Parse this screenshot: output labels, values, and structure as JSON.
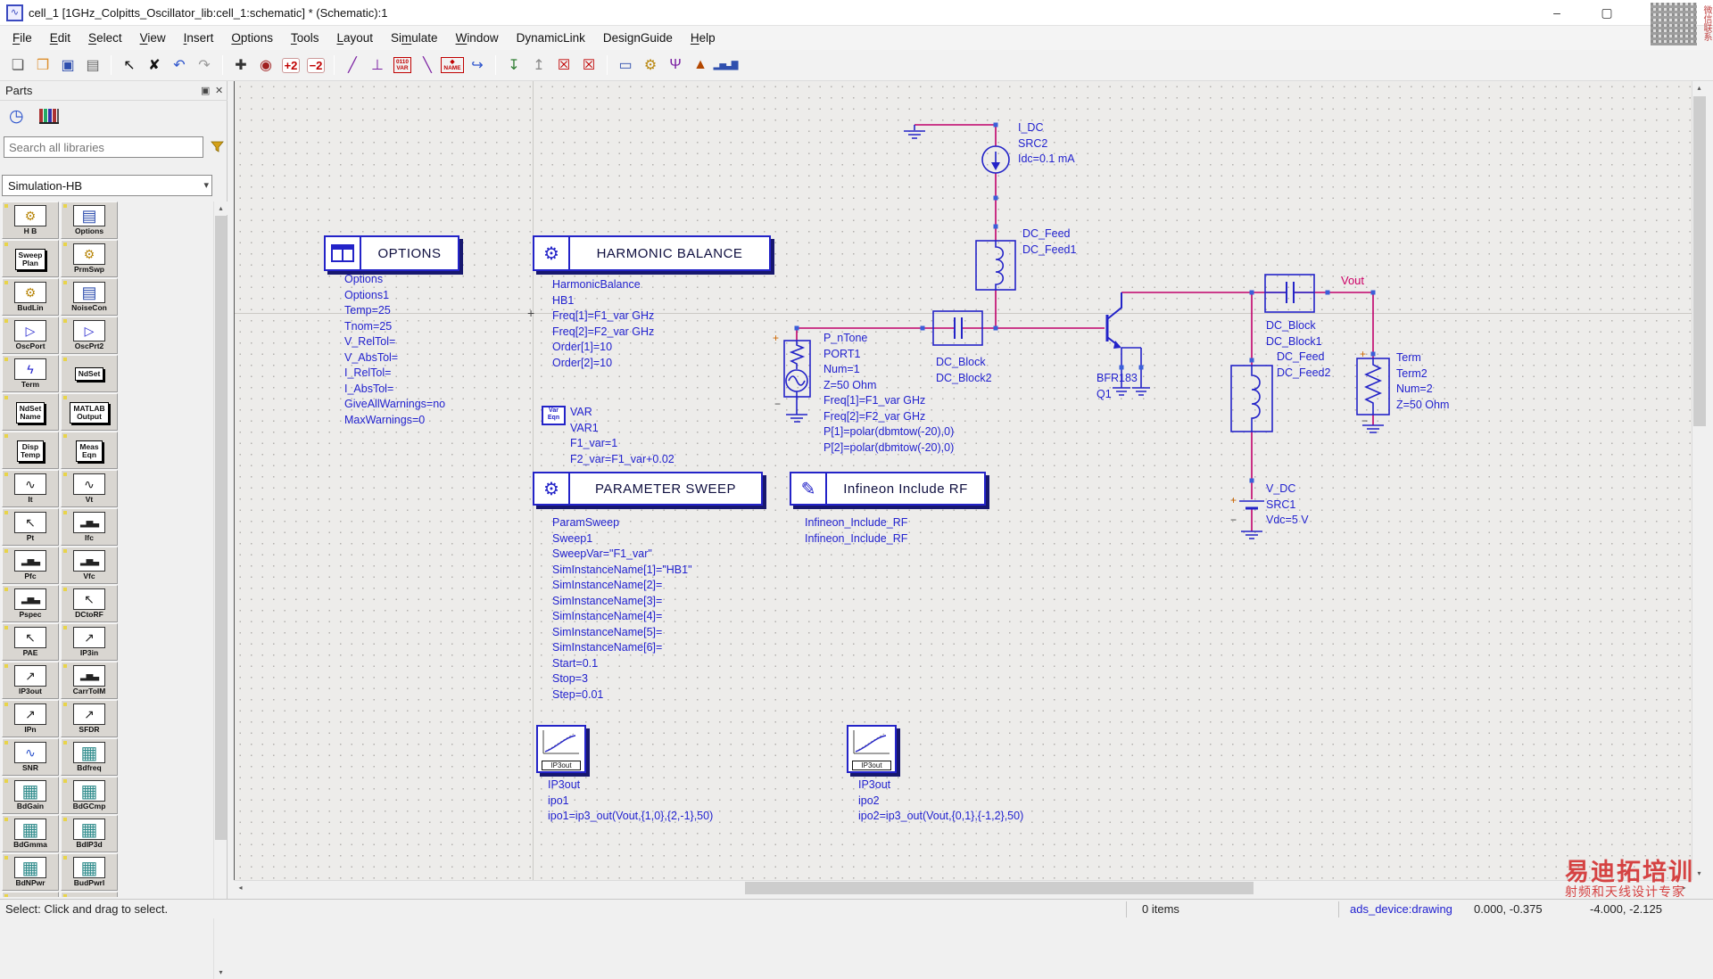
{
  "colors": {
    "symbol_blue": "#2323c8",
    "wire_magenta": "#c0006a",
    "type_cyan": "#2da0e0",
    "param_blue": "#2222cf",
    "watermark_red": "#d54242"
  },
  "window": {
    "title": "cell_1 [1GHz_Colpitts_Oscillator_lib:cell_1:schematic] * (Schematic):1",
    "minimize_glyph": "–",
    "maximize_glyph": "▢"
  },
  "menu": [
    {
      "pre": "",
      "u": "F",
      "post": "ile"
    },
    {
      "pre": "",
      "u": "E",
      "post": "dit"
    },
    {
      "pre": "",
      "u": "S",
      "post": "elect"
    },
    {
      "pre": "",
      "u": "V",
      "post": "iew"
    },
    {
      "pre": "",
      "u": "I",
      "post": "nsert"
    },
    {
      "pre": "",
      "u": "O",
      "post": "ptions"
    },
    {
      "pre": "",
      "u": "T",
      "post": "ools"
    },
    {
      "pre": "",
      "u": "L",
      "post": "ayout"
    },
    {
      "pre": "Si",
      "u": "m",
      "post": "ulate"
    },
    {
      "pre": "",
      "u": "W",
      "post": "indow"
    },
    {
      "pre": "DynamicLink",
      "u": "",
      "post": ""
    },
    {
      "pre": "DesignGuide",
      "u": "",
      "post": ""
    },
    {
      "pre": "",
      "u": "H",
      "post": "elp"
    }
  ],
  "toolbar": [
    {
      "cls": "tbtn",
      "name": "new-design",
      "glyph": "❏",
      "color": "#555",
      "inter": "true"
    },
    {
      "cls": "tbtn",
      "name": "open-design",
      "glyph": "❒",
      "color": "#dd8f2d",
      "inter": "true"
    },
    {
      "cls": "tbtn",
      "name": "save-design",
      "glyph": "▣",
      "color": "#2f4fae",
      "inter": "true"
    },
    {
      "cls": "tbtn",
      "name": "print",
      "glyph": "▤",
      "color": "#666",
      "inter": "true"
    },
    {
      "cls": "tsep",
      "name": "separator",
      "glyph": "",
      "color": "",
      "inter": "false"
    },
    {
      "cls": "tbtn",
      "name": "select-pointer",
      "glyph": "↖",
      "color": "#111",
      "inter": "true"
    },
    {
      "cls": "tbtn",
      "name": "delete",
      "glyph": "✘",
      "color": "#111",
      "inter": "true"
    },
    {
      "cls": "tbtn",
      "name": "undo",
      "glyph": "↶",
      "color": "#2a52cc",
      "inter": "true"
    },
    {
      "cls": "tbtn",
      "name": "redo",
      "glyph": "↷",
      "color": "#999",
      "inter": "true"
    },
    {
      "cls": "tsep",
      "name": "separator",
      "glyph": "",
      "color": "",
      "inter": "false"
    },
    {
      "cls": "tbtn",
      "name": "pan",
      "glyph": "✚",
      "color": "#333",
      "inter": "true"
    },
    {
      "cls": "tbtn",
      "name": "zoom-area",
      "glyph": "◉",
      "color": "#a02020",
      "inter": "true"
    },
    {
      "cls": "tbtn zoomtxt",
      "name": "zoom-in",
      "glyph": "+2",
      "color": "#c00000",
      "inter": "true"
    },
    {
      "cls": "tbtn zoomtxt",
      "name": "zoom-out",
      "glyph": "−2",
      "color": "#c00000",
      "inter": "true"
    },
    {
      "cls": "tsep",
      "name": "separator",
      "glyph": "",
      "color": "",
      "inter": "false"
    },
    {
      "cls": "tbtn",
      "name": "insert-wire",
      "glyph": "╱",
      "color": "#7a1fa2",
      "inter": "true"
    },
    {
      "cls": "tbtn",
      "name": "insert-ground",
      "glyph": "⊥",
      "color": "#7a1fa2",
      "inter": "true"
    },
    {
      "cls": "tbtn varbox",
      "name": "insert-var",
      "glyph": "0110\nVAR",
      "color": "#c00000",
      "inter": "true"
    },
    {
      "cls": "tbtn",
      "name": "insert-wire-label",
      "glyph": "╲",
      "color": "#7a1fa2",
      "inter": "true"
    },
    {
      "cls": "tbtn namebox",
      "name": "node-name",
      "glyph": "◆\nNAME",
      "color": "#c00000",
      "inter": "true"
    },
    {
      "cls": "tbtn",
      "name": "wire-route",
      "glyph": "↪",
      "color": "#2a52cc",
      "inter": "true"
    },
    {
      "cls": "tsep",
      "name": "separator",
      "glyph": "",
      "color": "",
      "inter": "false"
    },
    {
      "cls": "tbtn",
      "name": "push-into-hierarchy",
      "glyph": "↧",
      "color": "#2e7d32",
      "inter": "true"
    },
    {
      "cls": "tbtn",
      "name": "pop-out-of-hierarchy",
      "glyph": "↥",
      "color": "#8a8a8a",
      "inter": "true"
    },
    {
      "cls": "tbtn",
      "name": "deactivate-component",
      "glyph": "☒",
      "color": "#c00000",
      "inter": "true"
    },
    {
      "cls": "tbtn",
      "name": "deactivate-short",
      "glyph": "☒",
      "color": "#c00000",
      "inter": "true"
    },
    {
      "cls": "tsep",
      "name": "separator",
      "glyph": "",
      "color": "",
      "inter": "false"
    },
    {
      "cls": "tbtn",
      "name": "data-display-window",
      "glyph": "▭",
      "color": "#2f4fae",
      "inter": "true"
    },
    {
      "cls": "tbtn",
      "name": "simulation-settings",
      "glyph": "⚙",
      "color": "#b8860b",
      "inter": "true"
    },
    {
      "cls": "tbtn",
      "name": "tune-parameters",
      "glyph": "Ψ",
      "color": "#7a1fa2",
      "inter": "true"
    },
    {
      "cls": "tbtn",
      "name": "simulate",
      "glyph": "▲",
      "color": "#b34700",
      "inter": "true"
    },
    {
      "cls": "tbtn spectrum",
      "name": "spectrum-display",
      "glyph": "▂▅▃▇",
      "color": "#2f4fae",
      "inter": "true"
    }
  ],
  "parts_panel": {
    "title": "Parts",
    "dock_icon": "▣",
    "close_icon": "✕",
    "history_icon": "◷",
    "search_placeholder": "Search all libraries",
    "palette": "Simulation-HB",
    "combo_arrow": "▾",
    "parts": [
      {
        "label": "H B",
        "icon": "gears"
      },
      {
        "label": "Options",
        "icon": "window"
      },
      {
        "label": "Sweep\nPlan",
        "icon": "textbox"
      },
      {
        "label": "PrmSwp",
        "icon": "gears"
      },
      {
        "label": "BudLin",
        "icon": "gears"
      },
      {
        "label": "NoiseCon",
        "icon": "window"
      },
      {
        "label": "OscPort",
        "icon": "osc"
      },
      {
        "label": "OscPrt2",
        "icon": "osc"
      },
      {
        "label": "Term",
        "icon": "term"
      },
      {
        "label": "NdSet",
        "icon": "textbox"
      },
      {
        "label": "NdSet\nName",
        "icon": "textbox"
      },
      {
        "label": "MATLAB\nOutput",
        "icon": "textbox"
      },
      {
        "label": "Disp\nTemp",
        "icon": "textbox"
      },
      {
        "label": "Meas\nEqn",
        "icon": "textbox"
      },
      {
        "label": "It",
        "icon": "curve"
      },
      {
        "label": "Vt",
        "icon": "curve"
      },
      {
        "label": "Pt",
        "icon": "arrow"
      },
      {
        "label": "Ifc",
        "icon": "bars"
      },
      {
        "label": "Pfc",
        "icon": "bars"
      },
      {
        "label": "Vfc",
        "icon": "bars"
      },
      {
        "label": "Pspec",
        "icon": "bars"
      },
      {
        "label": "DCtoRF",
        "icon": "arrow"
      },
      {
        "label": "PAE",
        "icon": "arrow"
      },
      {
        "label": "IP3in",
        "icon": "ip3"
      },
      {
        "label": "IP3out",
        "icon": "ip3"
      },
      {
        "label": "CarrToIM",
        "icon": "bars"
      },
      {
        "label": "IPn",
        "icon": "ip3"
      },
      {
        "label": "SFDR",
        "icon": "ip3"
      },
      {
        "label": "SNR",
        "icon": "snr"
      },
      {
        "label": "Bdfreq",
        "icon": "table"
      },
      {
        "label": "BdGain",
        "icon": "table"
      },
      {
        "label": "BdGCmp",
        "icon": "table"
      },
      {
        "label": "BdGmma",
        "icon": "table"
      },
      {
        "label": "BdIP3d",
        "icon": "table"
      },
      {
        "label": "BdNPwr",
        "icon": "table"
      },
      {
        "label": "BudPwrI",
        "icon": "table"
      },
      {
        "label": "",
        "icon": "table"
      },
      {
        "label": "",
        "icon": "table"
      }
    ]
  },
  "icon_glyphs": {
    "gears": "⚙",
    "window": "▤",
    "osc": "▷",
    "term": "ϟ",
    "curve": "∿",
    "arrow": "↖",
    "bars": "▂▅▃",
    "ip3": "↗",
    "snr": "∿",
    "table": "▦",
    "textbox": ""
  },
  "schematic": {
    "title_blocks": {
      "options": "OPTIONS",
      "hb": "HARMONIC BALANCE",
      "psweep": "PARAMETER SWEEP",
      "infineon": "Infineon Include RF"
    },
    "icons": {
      "hb_gear": "⚙",
      "psweep_gear": "⚙",
      "infineon_pen": "✎"
    },
    "var_icon_line1": "Var",
    "var_icon_line2": "Eqn",
    "ip3_icon_label": "IP3out",
    "vout_label": "Vout",
    "plus_sign": "+",
    "minus_sign": "−",
    "blocks": {
      "options": [
        "Options",
        "Options1",
        "Temp=25",
        "Tnom=25",
        "V_RelTol=",
        "V_AbsTol=",
        "I_RelTol=",
        "I_AbsTol=",
        "GiveAllWarnings=no",
        "MaxWarnings=0"
      ],
      "hb": [
        "HarmonicBalance",
        "HB1",
        "Freq[1]=F1_var GHz",
        "Freq[2]=F2_var GHz",
        "Order[1]=10",
        "Order[2]=10"
      ],
      "var": [
        "VAR",
        "VAR1",
        "F1_var=1",
        "F2_var=F1_var+0.02"
      ],
      "psweep": [
        "ParamSweep",
        "Sweep1",
        "SweepVar=\"F1_var\"",
        "SimInstanceName[1]=\"HB1\"",
        "SimInstanceName[2]=",
        "SimInstanceName[3]=",
        "SimInstanceName[4]=",
        "SimInstanceName[5]=",
        "SimInstanceName[6]=",
        "Start=0.1",
        "Stop=3",
        "Step=0.01"
      ],
      "infineon": [
        "Infineon_Include_RF",
        "Infineon_Include_RF"
      ],
      "pntone": [
        "P_nTone",
        "PORT1",
        "Num=1",
        "Z=50 Ohm",
        "Freq[1]=F1_var GHz",
        "Freq[2]=F2_var GHz",
        "P[1]=polar(dbmtow(-20),0)",
        "P[2]=polar(dbmtow(-20),0)"
      ],
      "dcblock2": [
        "DC_Block",
        "DC_Block2"
      ],
      "idc": [
        "I_DC",
        "SRC2",
        "Idc=0.1 mA"
      ],
      "dcfeed1": [
        "DC_Feed",
        "DC_Feed1"
      ],
      "dcblock1": [
        "DC_Block",
        "DC_Block1"
      ],
      "dcfeed2": [
        "DC_Feed",
        "DC_Feed2"
      ],
      "term2": [
        "Term",
        "Term2",
        "Num=2",
        "Z=50 Ohm"
      ],
      "vdc": [
        "V_DC",
        "SRC1",
        "Vdc=5 V"
      ],
      "q1": [
        "BFR183",
        "Q1"
      ],
      "ip3out1": [
        "IP3out",
        "ipo1",
        "ipo1=ip3_out(Vout,{1,0},{2,-1},50)"
      ],
      "ip3out2": [
        "IP3out",
        "ipo2",
        "ipo2=ip3_out(Vout,{0,1},{-1,2},50)"
      ]
    }
  },
  "scrollbars": {
    "up": "▴",
    "down": "▾",
    "left": "◂",
    "right": "▸"
  },
  "status_bar": {
    "hint": "Select: Click and drag to select.",
    "items": "0 items",
    "context": "ads_device:drawing",
    "coords": "0.000, -0.375",
    "coords2": "-4.000, -2.125"
  },
  "watermark": {
    "qr_caption": "微信联系",
    "line1": "易迪拓培训",
    "line2": "射频和天线设计专家"
  }
}
